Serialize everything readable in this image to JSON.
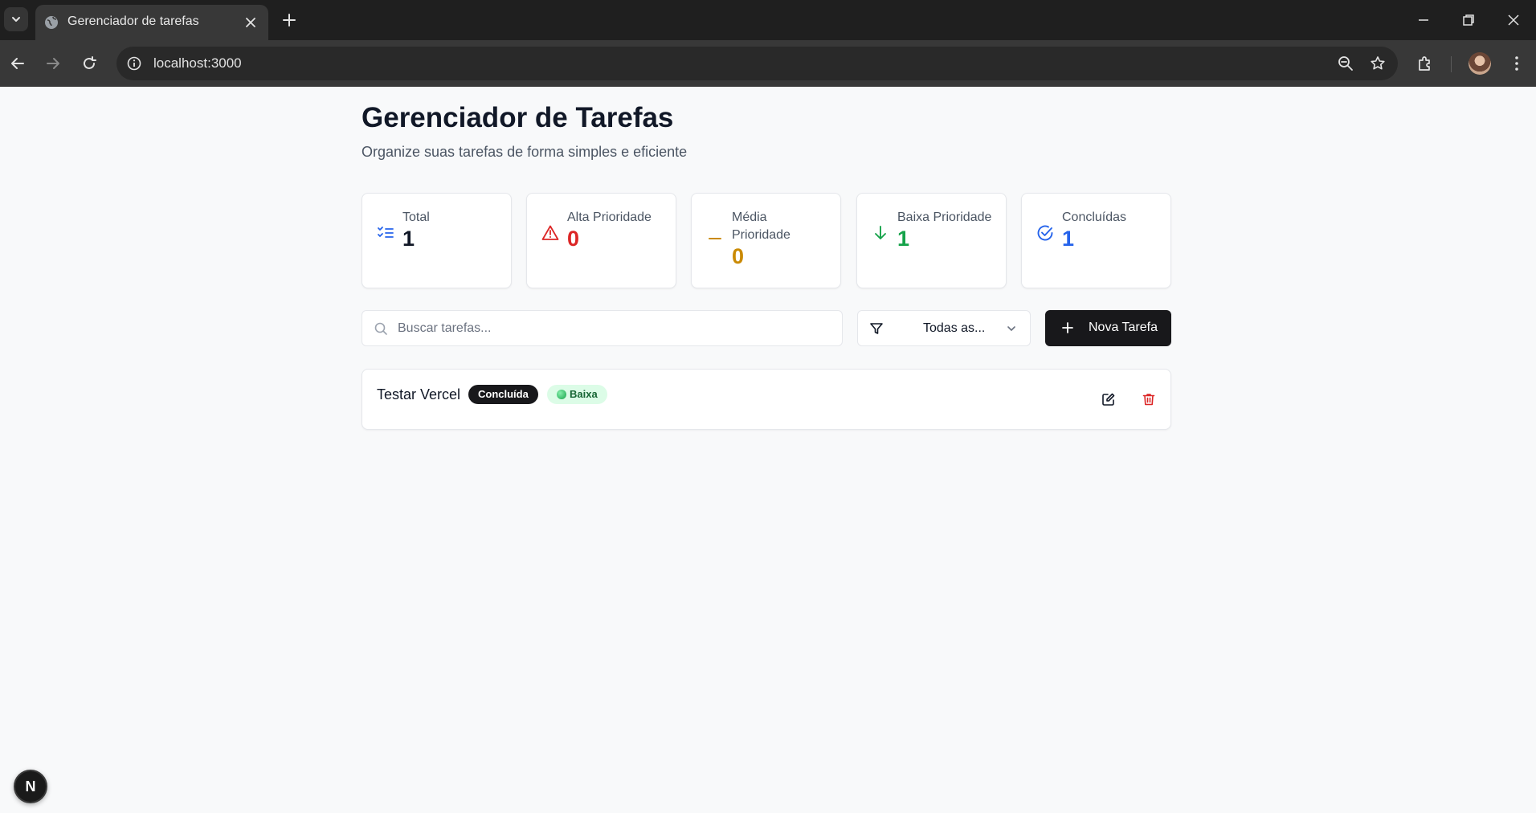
{
  "browser": {
    "tab_title": "Gerenciador de tarefas",
    "url": "localhost:3000"
  },
  "header": {
    "title": "Gerenciador de Tarefas",
    "subtitle": "Organize suas tarefas de forma simples e eficiente"
  },
  "stats": [
    {
      "label": "Total",
      "value": "1",
      "icon": "list-checks-icon",
      "color": "#111827",
      "icon_color": "#2563eb"
    },
    {
      "label": "Alta Prioridade",
      "value": "0",
      "icon": "alert-triangle-icon",
      "color": "#dc2626",
      "icon_color": "#dc2626"
    },
    {
      "label": "Média Prioridade",
      "value": "0",
      "icon": "minus-icon",
      "color": "#ca8a04",
      "icon_color": "#ca8a04"
    },
    {
      "label": "Baixa Prioridade",
      "value": "1",
      "icon": "arrow-down-icon",
      "color": "#16a34a",
      "icon_color": "#16a34a"
    },
    {
      "label": "Concluídas",
      "value": "1",
      "icon": "check-circle-icon",
      "color": "#2563eb",
      "icon_color": "#2563eb"
    }
  ],
  "search": {
    "placeholder": "Buscar tarefas...",
    "value": ""
  },
  "filter": {
    "selected": "Todas as..."
  },
  "new_task_button": {
    "label": "Nova Tarefa"
  },
  "tasks": [
    {
      "title": "Testar Vercel",
      "status": "Concluída",
      "priority": "Baixa"
    }
  ],
  "dev_badge": {
    "label": "N"
  }
}
